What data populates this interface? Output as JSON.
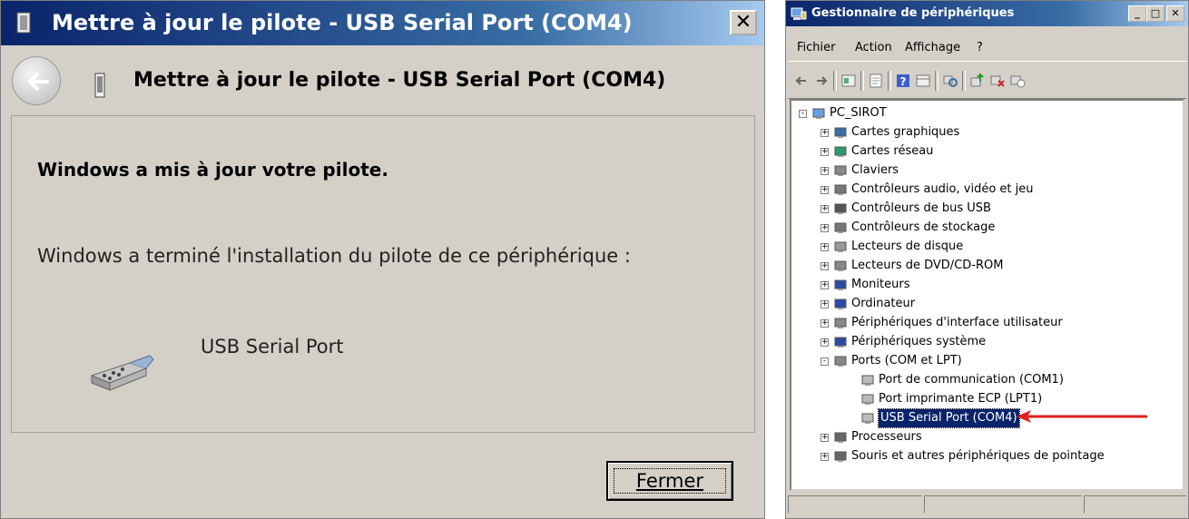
{
  "dialog": {
    "title": "Mettre à jour le pilote - USB Serial Port (COM4)",
    "close_glyph": "✕",
    "heading": "Mettre à jour le pilote - USB Serial Port (COM4)",
    "message_bold": "Windows a mis à jour votre pilote.",
    "message": "Windows a terminé l'installation du pilote de ce périphérique :",
    "device_name": "USB Serial Port",
    "close_button": "Fermer"
  },
  "devmgr": {
    "title": "Gestionnaire de périphériques",
    "window_buttons": [
      "_",
      "□",
      "✕"
    ],
    "menu": [
      "Fichier",
      "Action",
      "Affichage",
      "?"
    ],
    "toolbar_icons": [
      "back-icon",
      "forward-icon",
      "show-hide-icon",
      "properties-icon",
      "help-icon",
      "view-icon",
      "scan-icon",
      "update-driver-icon",
      "uninstall-icon",
      "disable-icon"
    ],
    "root": "PC_SIROT",
    "categories": [
      "Cartes graphiques",
      "Cartes réseau",
      "Claviers",
      "Contrôleurs audio, vidéo et jeu",
      "Contrôleurs de bus USB",
      "Contrôleurs de stockage",
      "Lecteurs de disque",
      "Lecteurs de DVD/CD-ROM",
      "Moniteurs",
      "Ordinateur",
      "Périphériques d'interface utilisateur",
      "Périphériques système",
      "Ports (COM et LPT)"
    ],
    "ports_children": [
      "Port de communication (COM1)",
      "Port imprimante ECP (LPT1)",
      "USB Serial Port (COM4)"
    ],
    "after_ports": [
      "Processeurs",
      "Souris et autres périphériques de pointage"
    ],
    "accent_selection": "#0a246a",
    "arrow_color": "#e02020"
  }
}
